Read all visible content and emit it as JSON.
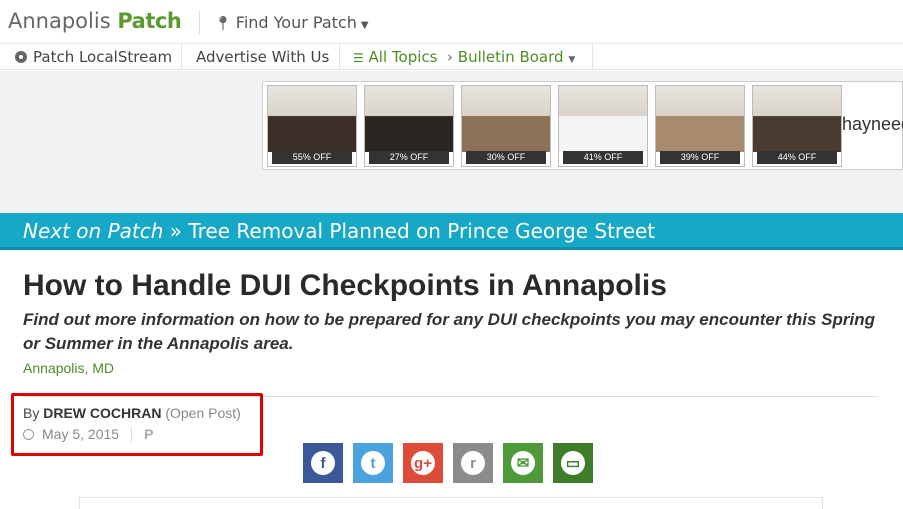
{
  "header": {
    "town": "Annapolis",
    "brand": "Patch",
    "find_patch": "Find Your Patch"
  },
  "nav": {
    "localstream": "Patch LocalStream",
    "advertise": "Advertise With Us",
    "all_topics": "All Topics",
    "bulletin_board": "Bulletin Board"
  },
  "ad": {
    "tiles": [
      {
        "discount": "55% OFF",
        "color": "#3a2e26"
      },
      {
        "discount": "27% OFF",
        "color": "#2b2622"
      },
      {
        "discount": "30% OFF",
        "color": "#8c7158"
      },
      {
        "discount": "41% OFF",
        "color": "#f4f4f4"
      },
      {
        "discount": "39% OFF",
        "color": "#a88a6e"
      },
      {
        "discount": "44% OFF",
        "color": "#4a3b30"
      }
    ],
    "brand": "hayneed"
  },
  "next_on_patch": {
    "lead": "Next on Patch",
    "sep": "»",
    "title": "Tree Removal Planned on Prince George Street"
  },
  "article": {
    "headline": "How to Handle DUI Checkpoints in Annapolis",
    "dek": "Find out more information on how to be prepared for any DUI checkpoints you may encounter this Spring or Summer in the Annapolis area.",
    "location": "Annapolis, MD",
    "by": "By",
    "author": "DREW COCHRAN",
    "post_type": "(Open Post)",
    "date": "May 5, 2015",
    "post_tag": "P"
  },
  "share": [
    {
      "name": "facebook",
      "glyph": "f",
      "color": "#3b5998"
    },
    {
      "name": "twitter",
      "glyph": "t",
      "color": "#4aa3df"
    },
    {
      "name": "google-plus",
      "glyph": "g+",
      "color": "#dd4b39"
    },
    {
      "name": "reddit",
      "glyph": "r",
      "color": "#8c8c8c"
    },
    {
      "name": "email",
      "glyph": "✉",
      "color": "#4e9a3a"
    },
    {
      "name": "comment",
      "glyph": "▭",
      "color": "#3f7d2a"
    }
  ]
}
